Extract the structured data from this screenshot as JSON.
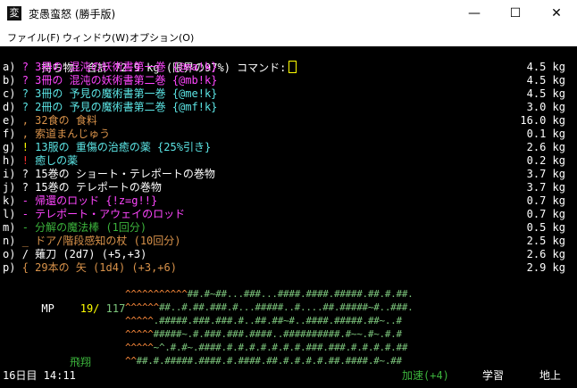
{
  "window": {
    "title": "変愚蛮怒 (勝手版)",
    "min": "—",
    "max": "☐",
    "close": "✕"
  },
  "menu": [
    "ファイル(F)",
    "ウィンドウ(W)",
    "オプション(O)"
  ],
  "header": "持ち物: 合計 72.9 kg (限界の97%) コマンド:",
  "items": [
    {
      "letter": "a)",
      "sym": "?",
      "text": "3冊の 混沌の妖術書第一巻 {@ma!k}",
      "weight": "4.5 kg",
      "color": "#ff46ff",
      "symcolor": "#ff46ff"
    },
    {
      "letter": "b)",
      "sym": "?",
      "text": "3冊の 混沌の妖術書第二巻 {@mb!k}",
      "weight": "4.5 kg",
      "color": "#ff46ff",
      "symcolor": "#ff46ff"
    },
    {
      "letter": "c)",
      "sym": "?",
      "text": "3冊の 予見の魔術書第一巻 {@me!k}",
      "weight": "4.5 kg",
      "color": "#5ce5e5",
      "symcolor": "#5ce5e5"
    },
    {
      "letter": "d)",
      "sym": "?",
      "text": "2冊の 予見の魔術書第二巻 {@mf!k}",
      "weight": "3.0 kg",
      "color": "#5ce5e5",
      "symcolor": "#5ce5e5"
    },
    {
      "letter": "e)",
      "sym": ",",
      "text": "32食の 食料",
      "weight": "16.0 kg",
      "color": "#d8924a",
      "symcolor": "#d8924a"
    },
    {
      "letter": "f)",
      "sym": ",",
      "text": "索道まんじゅう",
      "weight": "0.1 kg",
      "color": "#d8924a",
      "symcolor": "#d8924a"
    },
    {
      "letter": "g)",
      "sym": "!",
      "text": "13服の 重傷の治癒の薬 {25%引き}",
      "weight": "2.6 kg",
      "color": "#5ce5e5",
      "symcolor": "#ffff00"
    },
    {
      "letter": "h)",
      "sym": "!",
      "text": "癒しの薬",
      "weight": "0.2 kg",
      "color": "#5ce5e5",
      "symcolor": "#ff3030"
    },
    {
      "letter": "i)",
      "sym": "?",
      "text": "15巻の ショート・テレポートの巻物",
      "weight": "3.7 kg",
      "color": "#ffffff",
      "symcolor": "#ffffff"
    },
    {
      "letter": "j)",
      "sym": "?",
      "text": "15巻の テレポートの巻物",
      "weight": "3.7 kg",
      "color": "#ffffff",
      "symcolor": "#ffffff"
    },
    {
      "letter": "k)",
      "sym": "-",
      "text": "帰還のロッド {!z=g!!}",
      "weight": "0.7 kg",
      "color": "#ff46ff",
      "symcolor": "#ff46ff"
    },
    {
      "letter": "l)",
      "sym": "-",
      "text": "テレポート・アウェイのロッド",
      "weight": "0.7 kg",
      "color": "#ff46ff",
      "symcolor": "#ff46ff"
    },
    {
      "letter": "m)",
      "sym": "-",
      "text": "分解の魔法棒 (1回分)",
      "weight": "0.5 kg",
      "color": "#3cb43c",
      "symcolor": "#3cb43c"
    },
    {
      "letter": "n)",
      "sym": "_",
      "text": "ドア/階段感知の杖 (10回分)",
      "weight": "2.5 kg",
      "color": "#d8924a",
      "symcolor": "#d8924a"
    },
    {
      "letter": "o)",
      "sym": "/",
      "text": "薙刀 (2d7) (+5,+3)",
      "weight": "2.6 kg",
      "color": "#ffffff",
      "symcolor": "#ffffff"
    },
    {
      "letter": "p)",
      "sym": "{",
      "text": "29本の 矢 (1d4) (+3,+6)",
      "weight": "2.9 kg",
      "color": "#d8924a",
      "symcolor": "#d8924a"
    }
  ],
  "mp": {
    "label": "MP",
    "cur": "19/",
    "max": "117"
  },
  "map": [
    "^^^^^^^^^^^##.#~##...###...####.####.#####.##.#.##.",
    "^^^^^^##..#.##.###.#...#####..#....##.#####~#..###.",
    "^^^^^.#####.###.###.#..##.##~#..####.#####.##~..#",
    "^^^^^#####~.#.###.###.####..##########.#~~.#~.#.#",
    "^^^^^~^.#.#~.####.#.#.#.#.#.#.#.###.###.#.#.#.#.##",
    "^^##.#.#####.####.#.####.##.#.#.#.#.##.####.#~.##"
  ],
  "status": {
    "fly": "飛翔",
    "day": "16日目 14:11",
    "speed": "加速(+4)",
    "learn": "学習",
    "ground": "地上"
  },
  "colors": {
    "orange": "#ff8c3c",
    "green": "#7ec87e",
    "cursor": "#ffff00"
  }
}
